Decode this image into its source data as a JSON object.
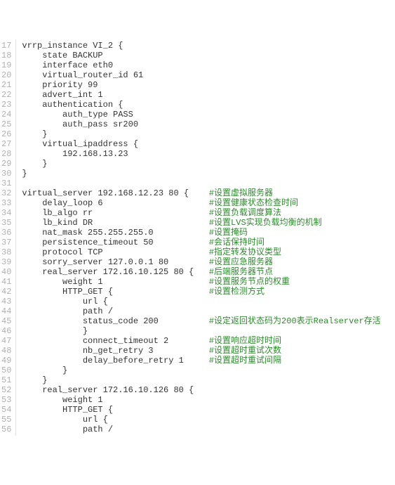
{
  "lines": [
    {
      "n": 17,
      "code": "vrrp_instance VI_2 {",
      "comment": ""
    },
    {
      "n": 18,
      "code": "    state BACKUP",
      "comment": ""
    },
    {
      "n": 19,
      "code": "    interface eth0",
      "comment": ""
    },
    {
      "n": 20,
      "code": "    virtual_router_id 61",
      "comment": ""
    },
    {
      "n": 21,
      "code": "    priority 99",
      "comment": ""
    },
    {
      "n": 22,
      "code": "    advert_int 1",
      "comment": ""
    },
    {
      "n": 23,
      "code": "    authentication {",
      "comment": ""
    },
    {
      "n": 24,
      "code": "        auth_type PASS",
      "comment": ""
    },
    {
      "n": 25,
      "code": "        auth_pass sr200",
      "comment": ""
    },
    {
      "n": 26,
      "code": "    }",
      "comment": ""
    },
    {
      "n": 27,
      "code": "    virtual_ipaddress {",
      "comment": ""
    },
    {
      "n": 28,
      "code": "        192.168.13.23",
      "comment": ""
    },
    {
      "n": 29,
      "code": "    }",
      "comment": ""
    },
    {
      "n": 30,
      "code": "}",
      "comment": ""
    },
    {
      "n": 31,
      "code": "",
      "comment": ""
    },
    {
      "n": 32,
      "code": "virtual_server 192.168.12.23 80 {    ",
      "comment": "#设置虚拟服务器"
    },
    {
      "n": 33,
      "code": "    delay_loop 6                     ",
      "comment": "#设置健康状态检查时间"
    },
    {
      "n": 34,
      "code": "    lb_algo rr                       ",
      "comment": "#设置负载调度算法"
    },
    {
      "n": 35,
      "code": "    lb_kind DR                       ",
      "comment": "#设置LVS实现负载均衡的机制"
    },
    {
      "n": 36,
      "code": "    nat_mask 255.255.255.0           ",
      "comment": "#设置掩码"
    },
    {
      "n": 37,
      "code": "    persistence_timeout 50           ",
      "comment": "#会话保持时间"
    },
    {
      "n": 38,
      "code": "    protocol TCP                     ",
      "comment": "#指定转发协议类型"
    },
    {
      "n": 39,
      "code": "    sorry_server 127.0.0.1 80        ",
      "comment": "#设置应急服务器"
    },
    {
      "n": 40,
      "code": "    real_server 172.16.10.125 80 {   ",
      "comment": "#后端服务器节点"
    },
    {
      "n": 41,
      "code": "        weight 1                     ",
      "comment": "#设置服务节点的权重"
    },
    {
      "n": 42,
      "code": "        HTTP_GET {                   ",
      "comment": "#设置检测方式"
    },
    {
      "n": 43,
      "code": "            url {",
      "comment": ""
    },
    {
      "n": 44,
      "code": "            path /",
      "comment": ""
    },
    {
      "n": 45,
      "code": "            status_code 200          ",
      "comment": "#设定返回状态码为200表示Realserver存活"
    },
    {
      "n": 46,
      "code": "            }",
      "comment": ""
    },
    {
      "n": 47,
      "code": "            connect_timeout 2        ",
      "comment": "#设置响应超时时间"
    },
    {
      "n": 48,
      "code": "            nb_get_retry 3           ",
      "comment": "#设置超时重试次数"
    },
    {
      "n": 49,
      "code": "            delay_before_retry 1     ",
      "comment": "#设置超时重试间隔"
    },
    {
      "n": 50,
      "code": "        }",
      "comment": ""
    },
    {
      "n": 51,
      "code": "    }",
      "comment": ""
    },
    {
      "n": 52,
      "code": "    real_server 172.16.10.126 80 {",
      "comment": ""
    },
    {
      "n": 53,
      "code": "        weight 1",
      "comment": ""
    },
    {
      "n": 54,
      "code": "        HTTP_GET {",
      "comment": ""
    },
    {
      "n": 55,
      "code": "            url {",
      "comment": ""
    },
    {
      "n": 56,
      "code": "            path /",
      "comment": ""
    }
  ]
}
